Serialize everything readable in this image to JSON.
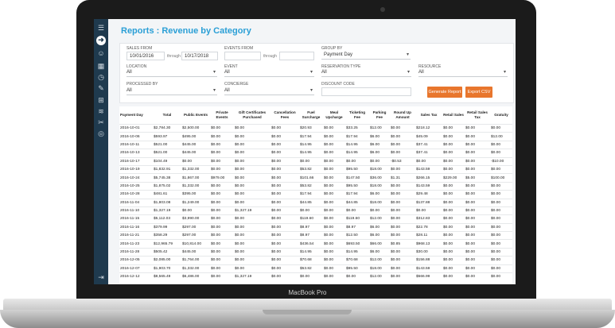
{
  "device": {
    "brand": "MacBook Pro"
  },
  "page": {
    "title": "Reports : Revenue by Category"
  },
  "sidebar": {
    "icons": [
      "menu-icon",
      "dashboard-icon",
      "user-icon",
      "calendar-icon",
      "clock-icon",
      "tag-icon",
      "cart-icon",
      "layers-icon",
      "tools-icon",
      "globe-icon",
      "logout-icon"
    ],
    "glyphs": [
      "☰",
      "➜",
      "☺",
      "▦",
      "◷",
      "✎",
      "⊞",
      "≋",
      "✂",
      "◎",
      "⇥"
    ]
  },
  "filters": {
    "sales_from": {
      "label": "SALES FROM",
      "from": "10/01/2016",
      "through_label": "through",
      "to": "10/17/2018"
    },
    "events_from": {
      "label": "EVENTS FROM",
      "from": "",
      "through_label": "through",
      "to": ""
    },
    "group_by": {
      "label": "GROUP BY",
      "value": "Payment Day"
    },
    "location": {
      "label": "LOCATION",
      "value": "All"
    },
    "event": {
      "label": "EVENT",
      "value": "All"
    },
    "reservation_type": {
      "label": "RESERVATION TYPE",
      "value": "All"
    },
    "resource": {
      "label": "RESOURCE",
      "value": "All"
    },
    "processed_by": {
      "label": "PROCESSED BY",
      "value": "All"
    },
    "concierge": {
      "label": "CONCIERGE",
      "value": "All"
    },
    "discount_code": {
      "label": "DISCOUNT CODE",
      "value": ""
    },
    "generate_label": "Generate Report",
    "export_label": "Export CSV"
  },
  "table": {
    "columns": [
      "Payment Day",
      "Total",
      "Public Events",
      "Private Events",
      "Gift Certificates Purchased",
      "Cancellation Fees",
      "Fuel Surcharge",
      "Meal Upcharge",
      "Ticketing Fee",
      "Parking Fee",
      "Round Up Amount",
      "Sales Tax",
      "Retail Sales",
      "Retail Sales Tax",
      "Gratuity"
    ],
    "rows": [
      [
        "2016-10-01",
        "$2,784.30",
        "$2,500.00",
        "$0.00",
        "$0.00",
        "$0.00",
        "$20.93",
        "$0.00",
        "$33.25",
        "$12.00",
        "$0.00",
        "$218.12",
        "$0.00",
        "$0.00",
        "$0.00"
      ],
      [
        "2016-10-06",
        "$593.97",
        "$495.00",
        "$0.00",
        "$0.00",
        "$0.00",
        "$17.94",
        "$0.00",
        "$17.94",
        "$6.00",
        "$0.00",
        "$45.09",
        "$0.00",
        "$0.00",
        "$12.00"
      ],
      [
        "2016-10-11",
        "$521.00",
        "$445.00",
        "$0.00",
        "$0.00",
        "$0.00",
        "$14.95",
        "$0.00",
        "$14.95",
        "$6.00",
        "$0.00",
        "$37.41",
        "$0.00",
        "$0.00",
        "$0.00"
      ],
      [
        "2016-10-13",
        "$521.00",
        "$445.00",
        "$0.00",
        "$0.00",
        "$0.00",
        "$14.95",
        "$0.00",
        "$14.95",
        "$6.00",
        "$0.00",
        "$37.41",
        "$0.00",
        "$0.00",
        "$0.00"
      ],
      [
        "2016-10-17",
        "$104.49",
        "$0.00",
        "$0.00",
        "$0.00",
        "$0.00",
        "$0.00",
        "$0.00",
        "$0.00",
        "$0.00",
        "-$0.53",
        "$0.00",
        "$0.00",
        "$0.00",
        "-$10.00"
      ],
      [
        "2016-10-19",
        "$1,832.91",
        "$1,332.00",
        "$0.00",
        "$0.00",
        "$0.00",
        "$53.82",
        "$0.00",
        "$95.50",
        "$18.00",
        "$0.00",
        "$143.59",
        "$0.00",
        "$0.00",
        "$0.00"
      ],
      [
        "2016-10-24",
        "$5,745.38",
        "$1,867.00",
        "$979.00",
        "$0.00",
        "$0.00",
        "$101.66",
        "$0.00",
        "$147.50",
        "$36.00",
        "$1.31",
        "$266.15",
        "$229.00",
        "$5.00",
        "$100.00"
      ],
      [
        "2016-10-25",
        "$1,875.02",
        "$1,332.00",
        "$0.00",
        "$0.00",
        "$0.00",
        "$53.82",
        "$0.00",
        "$95.50",
        "$18.00",
        "$0.00",
        "$143.59",
        "$0.00",
        "$0.00",
        "$0.00"
      ],
      [
        "2016-10-28",
        "$481.61",
        "$395.00",
        "$0.00",
        "$0.00",
        "$0.00",
        "$17.94",
        "$0.00",
        "$17.94",
        "$6.00",
        "$0.00",
        "$29.48",
        "$0.00",
        "$0.00",
        "$0.00"
      ],
      [
        "2016-11-04",
        "$1,803.08",
        "$1,249.00",
        "$0.00",
        "$0.00",
        "$0.00",
        "$44.85",
        "$0.00",
        "$44.85",
        "$18.00",
        "$0.00",
        "$137.88",
        "$0.00",
        "$0.00",
        "$0.00"
      ],
      [
        "2016-11-10",
        "$1,327.19",
        "$0.00",
        "$0.00",
        "$1,327.19",
        "$0.00",
        "$0.00",
        "$0.00",
        "$0.00",
        "$0.00",
        "$0.00",
        "$0.00",
        "$0.00",
        "$0.00",
        "$0.00"
      ],
      [
        "2016-11-15",
        "$5,112.03",
        "$3,990.00",
        "$0.00",
        "$0.00",
        "$0.00",
        "$119.60",
        "$0.00",
        "$119.60",
        "$12.00",
        "$0.00",
        "$312.83",
        "$0.00",
        "$0.00",
        "$0.00"
      ],
      [
        "2016-11-16",
        "$379.99",
        "$297.00",
        "$0.00",
        "$0.00",
        "$0.00",
        "$8.97",
        "$0.00",
        "$8.97",
        "$6.00",
        "$0.00",
        "$22.78",
        "$0.00",
        "$0.00",
        "$0.00"
      ],
      [
        "2016-11-21",
        "$358.29",
        "$297.00",
        "$0.00",
        "$0.00",
        "$0.00",
        "$8.97",
        "$0.00",
        "$12.50",
        "$6.00",
        "$0.00",
        "$28.11",
        "$0.00",
        "$0.00",
        "$0.00"
      ],
      [
        "2016-11-23",
        "$12,965.79",
        "$10,814.00",
        "$0.00",
        "$0.00",
        "$0.00",
        "$436.54",
        "$0.00",
        "$693.50",
        "$66.00",
        "$0.85",
        "$968.13",
        "$0.00",
        "$0.00",
        "$0.00"
      ],
      [
        "2016-11-28",
        "$505.42",
        "$445.00",
        "$0.00",
        "$0.00",
        "$0.00",
        "$14.95",
        "$0.00",
        "$14.95",
        "$6.00",
        "$0.00",
        "$30.00",
        "$0.00",
        "$0.00",
        "$0.00"
      ],
      [
        "2016-12-05",
        "$2,085.00",
        "$1,764.00",
        "$0.00",
        "$0.00",
        "$0.00",
        "$70.68",
        "$0.00",
        "$70.68",
        "$12.00",
        "$0.00",
        "$156.88",
        "$0.00",
        "$0.00",
        "$0.00"
      ],
      [
        "2016-12-07",
        "$1,903.70",
        "$1,332.00",
        "$0.00",
        "$0.00",
        "$0.00",
        "$53.82",
        "$0.00",
        "$95.50",
        "$18.00",
        "$0.00",
        "$143.59",
        "$0.00",
        "$0.00",
        "$0.00"
      ],
      [
        "2016-12-12",
        "$8,565.49",
        "$6,486.00",
        "$0.00",
        "$1,327.19",
        "$0.00",
        "$0.00",
        "$0.00",
        "$0.00",
        "$12.00",
        "$0.00",
        "$566.99",
        "$0.00",
        "$0.00",
        "$0.00"
      ]
    ]
  }
}
